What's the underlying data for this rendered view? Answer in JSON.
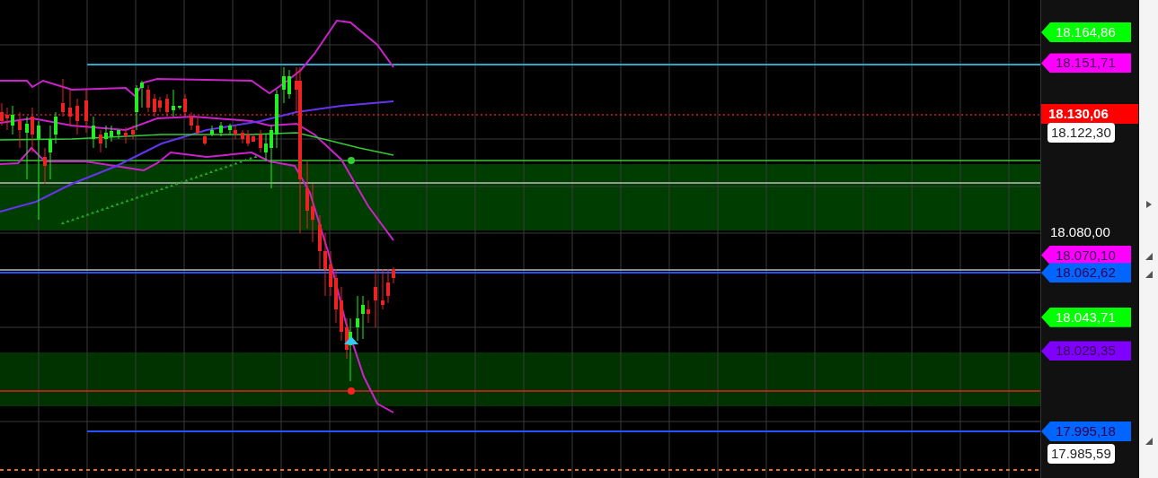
{
  "price_axis": {
    "labels": [
      {
        "kind": "tag",
        "text": "18.164,86",
        "color": "#00ff00"
      },
      {
        "kind": "tag",
        "text": "18.151,71",
        "color": "#ff00ff"
      },
      {
        "kind": "flag",
        "text": "18.130,06",
        "color": "#ff0000"
      },
      {
        "kind": "box",
        "text": "18.122,30"
      },
      {
        "kind": "plain",
        "text": "18.080,00"
      },
      {
        "kind": "tag",
        "text": "18.070,10",
        "color": "#ff00ff"
      },
      {
        "kind": "tag",
        "text": "18.062,62",
        "color": "#0066ff"
      },
      {
        "kind": "tag",
        "text": "18.043,71",
        "color": "#00ff00"
      },
      {
        "kind": "tag",
        "text": "18.029,35",
        "color": "#8000ff"
      },
      {
        "kind": "tag",
        "text": "17.995,18",
        "color": "#0066ff"
      },
      {
        "kind": "box",
        "text": "17.985,59"
      }
    ]
  }
}
